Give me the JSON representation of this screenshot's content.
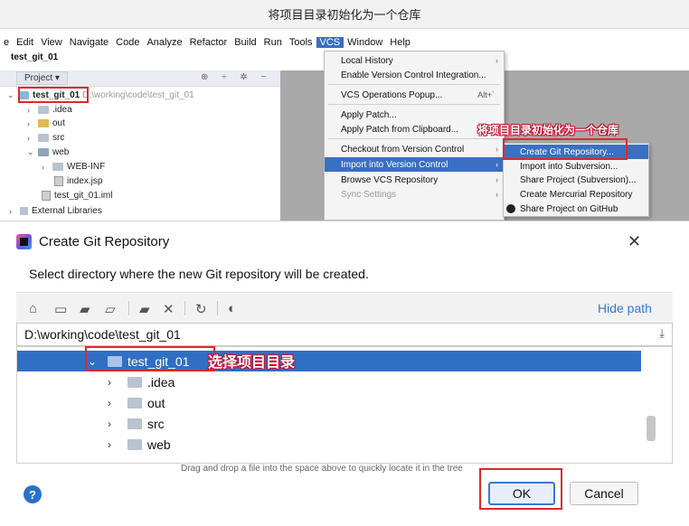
{
  "title_bar": {
    "text": "将项目目录初始化为一个仓库"
  },
  "ide": {
    "menu": [
      "e",
      "Edit",
      "View",
      "Navigate",
      "Code",
      "Analyze",
      "Refactor",
      "Build",
      "Run",
      "Tools",
      "VCS",
      "Window",
      "Help"
    ],
    "active_menu": "VCS",
    "project_name": "test_git_01",
    "project_tab": "Project",
    "project_tab_arrow": "▾",
    "panel_tools": "⊕ ÷ ✲ −",
    "tree": {
      "root": {
        "label": "test_git_01",
        "path": "D:\\working\\code\\test_git_01"
      },
      "idea": ".idea",
      "out": "out",
      "src": "src",
      "web": "web",
      "webinf": "WEB-INF",
      "indexjsp": "index.jsp",
      "iml": "test_git_01.iml",
      "external": "External Libraries"
    }
  },
  "vcs_menu": {
    "local_history": "Local History",
    "enable_vc": "Enable Version Control Integration...",
    "vcs_popup": "VCS Operations Popup...",
    "vcs_popup_shortcut": "Alt+`",
    "apply_patch": "Apply Patch...",
    "apply_patch_clipboard": "Apply Patch from Clipboard...",
    "checkout": "Checkout from Version Control",
    "import_vc": "Import into Version Control",
    "browse_vcs": "Browse VCS Repository",
    "sync_settings": "Sync Settings"
  },
  "import_submenu": {
    "create_git": "Create Git Repository...",
    "import_svn": "Import into Subversion...",
    "share_svn": "Share Project (Subversion)...",
    "create_hg": "Create Mercurial Repository",
    "share_github": "Share Project on GitHub"
  },
  "annotations": {
    "init_repo": "将项目目录初始化为一个仓库",
    "select_dir": "选择项目目录"
  },
  "dialog": {
    "title": "Create Git Repository",
    "prompt": "Select directory where the new Git repository will be created.",
    "hide_path": "Hide path",
    "path_value": "D:\\working\\code\\test_git_01",
    "tree": {
      "selected": "test_git_01",
      "idea": ".idea",
      "out": "out",
      "src": "src",
      "web": "web"
    },
    "hint": "Drag and drop a file into the space above to quickly locate it in the tree",
    "ok_label": "OK",
    "cancel_label": "Cancel",
    "help_label": "?"
  },
  "colors": {
    "accent_blue": "#3b6fc1",
    "highlight_red": "#e02828",
    "link_blue": "#2f7bd6"
  }
}
